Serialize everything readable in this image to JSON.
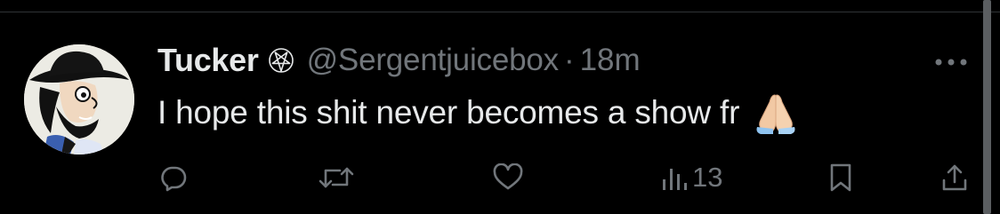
{
  "tweet": {
    "display_name": "Tucker",
    "name_symbol_icon": "pentagram-icon",
    "handle": "@Sergentjuicebox",
    "separator": "·",
    "timestamp": "18m",
    "text": "I hope this shit never becomes a show fr",
    "emoji": "folded-hands-emoji"
  },
  "actions": {
    "reply_icon": "reply-icon",
    "retweet_icon": "retweet-icon",
    "like_icon": "heart-icon",
    "views_icon": "views-icon",
    "views_count": "13",
    "bookmark_icon": "bookmark-icon",
    "share_icon": "share-icon"
  },
  "colors": {
    "background": "#000000",
    "primary_text": "#e7e9ea",
    "secondary_text": "#71767b",
    "divider": "#2f3336"
  }
}
